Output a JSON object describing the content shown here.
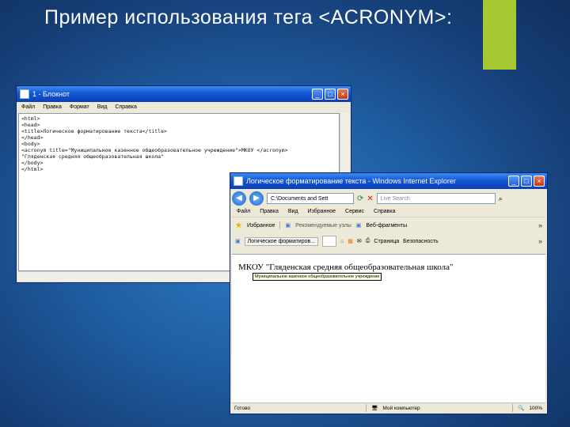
{
  "slide": {
    "title": "Пример использования  тега <ACRONYM>:"
  },
  "notepad": {
    "title": "1 - Блокнот",
    "menu": [
      "Файл",
      "Правка",
      "Формат",
      "Вид",
      "Справка"
    ],
    "code": "<html>\n<head>\n<title>Логическое форматирование текста</title>\n</head>\n<body>\n<acronym title=\"Муниципальное казенное общеобразовательное учреждение\">МКОУ </acronym>\n\"Гляденская средняя общеобразовательная школа\"\n</body>\n</html>"
  },
  "ie": {
    "title": "Логическое форматирование текста - Windows Internet Explorer",
    "address": "C:\\Documents and Sett",
    "search_placeholder": "Live Search",
    "menu": [
      "Файл",
      "Правка",
      "Вид",
      "Избранное",
      "Сервис",
      "Справка"
    ],
    "favorites_label": "Избранное",
    "fav_item_1": "Рекомендуемые узлы",
    "fav_item_2": "Веб-фрагменты",
    "tab_label": "Логическое форматиров...",
    "page_label": "Страница",
    "safety_label": "Безопасность",
    "page_text": "МКОУ \"Гляденская средняя общеобразовательная школа\"",
    "tooltip": "Муниципальное казенное общеобразовательное учреждение",
    "status_left": "Готово",
    "status_mid": "Мой компьютер",
    "status_zoom": "100%"
  }
}
